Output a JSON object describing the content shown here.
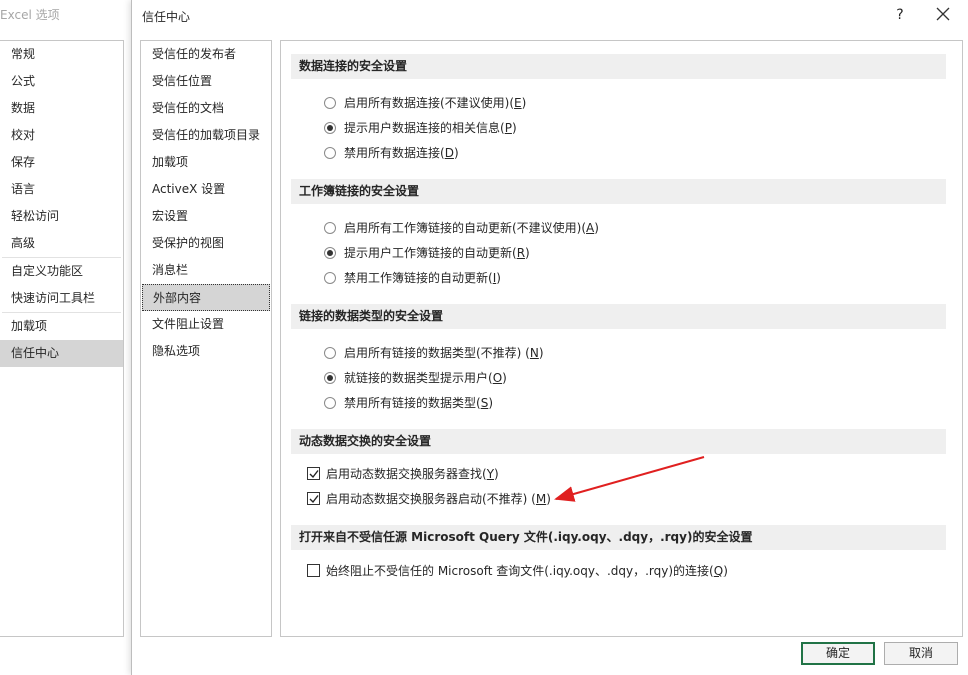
{
  "excel_options": {
    "title": "Excel 选项",
    "nav": [
      "常规",
      "公式",
      "数据",
      "校对",
      "保存",
      "语言",
      "轻松访问",
      "高级",
      "自定义功能区",
      "快速访问工具栏",
      "加载项",
      "信任中心"
    ],
    "selected": "信任中心"
  },
  "dialog": {
    "title": "信任中心",
    "help": "?",
    "nav": [
      "受信任的发布者",
      "受信任位置",
      "受信任的文档",
      "受信任的加载项目录",
      "加载项",
      "ActiveX 设置",
      "宏设置",
      "受保护的视图",
      "消息栏",
      "外部内容",
      "文件阻止设置",
      "隐私选项"
    ],
    "selected": "外部内容"
  },
  "sections": {
    "data_conn": {
      "title": "数据连接的安全设置",
      "options": [
        {
          "text": "启用所有数据连接(不建议使用)(",
          "key": "E",
          "end": ")",
          "selected": false
        },
        {
          "text": "提示用户数据连接的相关信息(",
          "key": "P",
          "end": ")",
          "selected": true
        },
        {
          "text": "禁用所有数据连接(",
          "key": "D",
          "end": ")",
          "selected": false
        }
      ]
    },
    "workbook_links": {
      "title": "工作簿链接的安全设置",
      "options": [
        {
          "text": "启用所有工作簿链接的自动更新(不建议使用)(",
          "key": "A",
          "end": ")",
          "selected": false
        },
        {
          "text": "提示用户工作簿链接的自动更新(",
          "key": "R",
          "end": ")",
          "selected": true
        },
        {
          "text": "禁用工作簿链接的自动更新(",
          "key": "I",
          "end": ")",
          "selected": false
        }
      ]
    },
    "linked_types": {
      "title": "链接的数据类型的安全设置",
      "options": [
        {
          "text": "启用所有链接的数据类型(不推荐) (",
          "key": "N",
          "end": ")",
          "selected": false
        },
        {
          "text": "就链接的数据类型提示用户(",
          "key": "O",
          "end": ")",
          "selected": true
        },
        {
          "text": "禁用所有链接的数据类型(",
          "key": "S",
          "end": ")",
          "selected": false
        }
      ]
    },
    "dde": {
      "title": "动态数据交换的安全设置",
      "options": [
        {
          "text": "启用动态数据交换服务器查找(",
          "key": "Y",
          "end": ")",
          "checked": true
        },
        {
          "text": "启用动态数据交换服务器启动(不推荐) (",
          "key": "M",
          "end": ")",
          "checked": true
        }
      ]
    },
    "msquery": {
      "title": "打开来自不受信任源 Microsoft Query 文件(.iqy.oqy、.dqy，.rqy)的安全设置",
      "options": [
        {
          "text": "始终阻止不受信任的 Microsoft 查询文件(.iqy.oqy、.dqy，.rqy)的连接(",
          "key": "Q",
          "end": ")",
          "checked": false
        }
      ]
    }
  },
  "buttons": {
    "ok": "确定",
    "cancel": "取消"
  },
  "annotation_color": "#e02020"
}
